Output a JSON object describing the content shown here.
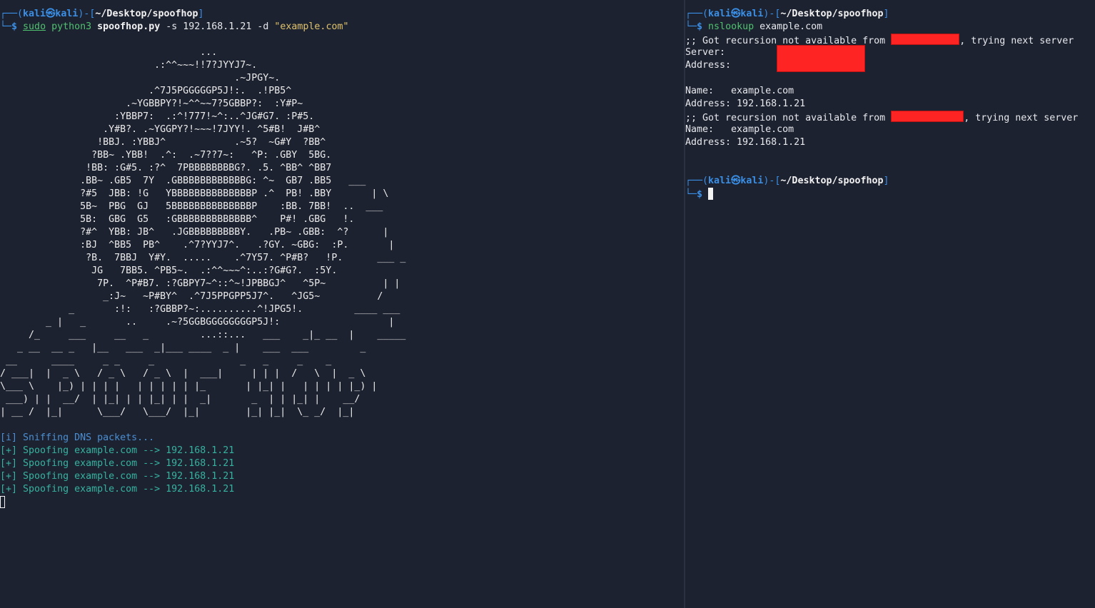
{
  "prompt": {
    "user": "kali",
    "skull": "㉿",
    "host": "kali",
    "path": "~/Desktop/spoofhop",
    "symbol": "$"
  },
  "left": {
    "command": {
      "sudo": "sudo",
      "program": "python3",
      "script": "spoofhop.py",
      "flag_s": "-s",
      "ip": "192.168.1.21",
      "flag_d": "-d",
      "domain": "\"example.com\""
    },
    "ascii_art": "                                   ...\n                           .:^^~~~!!7?JYYJ7~.\n                                         .~JPGY~.\n                          .^7J5PGGGGGP5J!:.  .!PB5^\n                      .~YGBBPY?!~^^~~7?5GBBP?:  :Y#P~\n                    :YBBP7:  .:^!777!~^:..^JG#G7. :P#5.\n                  .Y#B?. .~YGGPY?!~~~!7JYY!. ^5#B!  J#B^\n                 !BBJ. :YBBJ^            .~5?  ~G#Y  ?BB^\n                ?BB~ .YBB!  .^:  .~7??7~:   ^P: .GBY  5BG.\n               !BB: :G#5. :?^  7PBBBBBBBBG?. .5. ^BB^ ^BB7\n              .BB~ .GB5  7Y  .GBBBBBBBBBBBBG: ^~  GB7 .BB5   ___\n              ?#5  JBB: !G   YBBBBBBBBBBBBBBP .^  PB! .BBY       | \\\n              5B~  PBG  GJ   5BBBBBBBBBBBBBBP    :BB. 7BB!  ..  ___\n              5B:  GBG  G5   :GBBBBBBBBBBBBB^    P#! .GBG   !.\n              ?#^  YBB: JB^   .JGBBBBBBBBBY.   .PB~ .GBB:  ^?      |\n              :BJ  ^BB5  PB^    .^7?YYJ7^.   .?GY. ~GBG:  :P.       |\n               ?B.  7BBJ  Y#Y.  .....    .^7Y57. ^P#B?   !P.      ___ _\n                JG   7BB5. ^PB5~.  .:^^~~~^:..:?G#G?.  :5Y.\n                 7P.  ^P#B7. :?GBPY7~^::^~!JPBBGJ^   ^5P~          | |\n                  _:J~   ~P#BY^  .^7J5PPGPP5J7^.   ^JG5~          /\n            _       :!:   :?GBBP?~:..........^!JPG5!.         ____ ___\n        _ |   _       ..     .~?5GGBGGGGGGGGP5J!:                   |\n     /_     ___     __   _         ...::...   ___    _|_ __  |    _____\n   _ __  __ _   |__   ___  _|___ ____  _ |    ___  ___         _\n __      ____     _ _     _               _   _     _    _\n/ ___|  |  _ \\   / _ \\   / _ \\  |  ___|     | | |  /   \\  |  _ \\\n\\___ \\    |_) | | | |   | | | | | |_       | |_| |   | | | | |_) |\n ___) | |  __/  | |_| | | |_| | |  _|       _  | | |_| |    __/\n| __ /  |_|      \\___/   \\___/  |_|        |_| |_|  \\_ _/  |_|",
    "output": [
      {
        "tag": "[i]",
        "text": " Sniffing DNS packets...",
        "kind": "info"
      },
      {
        "tag": "[+]",
        "text": " Spoofing example.com --> 192.168.1.21",
        "kind": "ok"
      },
      {
        "tag": "[+]",
        "text": " Spoofing example.com --> 192.168.1.21",
        "kind": "ok"
      },
      {
        "tag": "[+]",
        "text": " Spoofing example.com --> 192.168.1.21",
        "kind": "ok"
      },
      {
        "tag": "[+]",
        "text": " Spoofing example.com --> 192.168.1.21",
        "kind": "ok"
      }
    ]
  },
  "right": {
    "command": {
      "program": "nslookup",
      "arg": "example.com"
    },
    "lines": {
      "recursion_prefix": ";; Got recursion not available from ",
      "recursion_suffix": ", trying next server",
      "server_label": "Server:",
      "address_label": "Address:",
      "name_label": "Name:",
      "name_value": "   example.com",
      "address_value": " 192.168.1.21"
    }
  }
}
